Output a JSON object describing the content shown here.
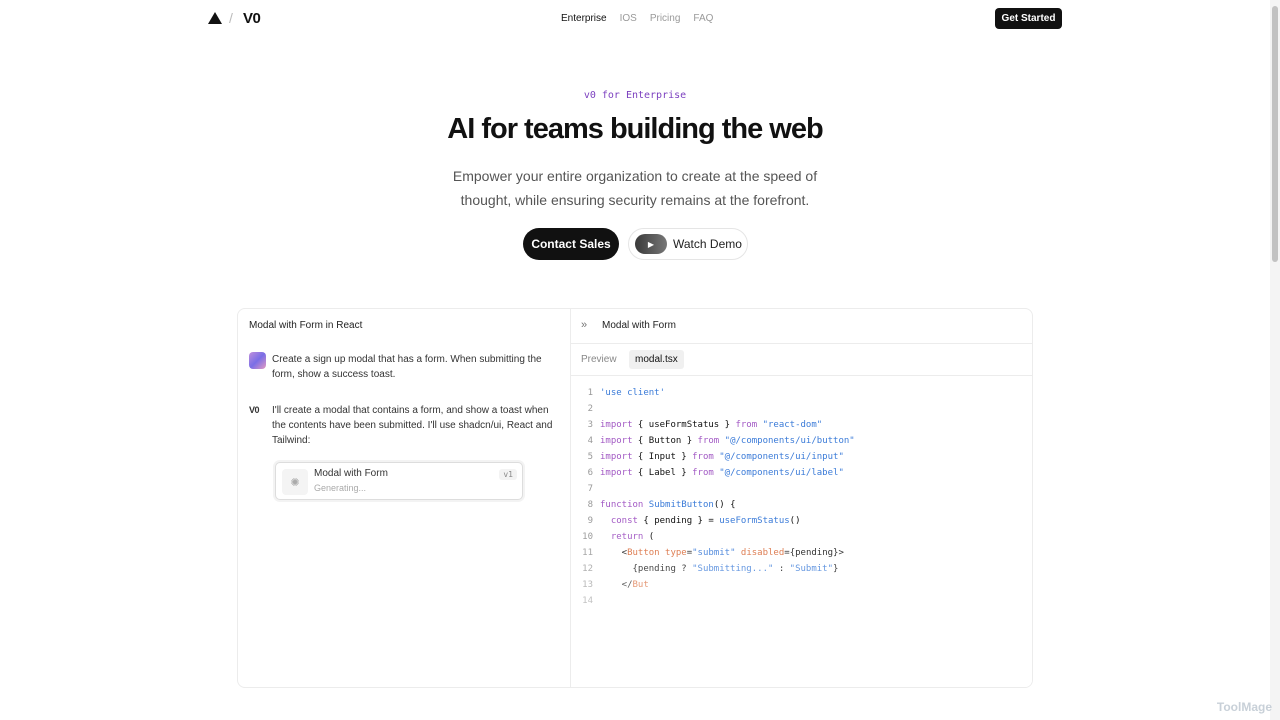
{
  "nav": {
    "logo_slash": "/",
    "logo_text": "V0",
    "links": [
      {
        "label": "Enterprise",
        "active": true
      },
      {
        "label": "IOS",
        "active": false
      },
      {
        "label": "Pricing",
        "active": false
      },
      {
        "label": "FAQ",
        "active": false
      }
    ],
    "cta": "Get Started"
  },
  "hero": {
    "eyebrow": "v0 for Enterprise",
    "title": "AI for teams building the web",
    "subtitle": "Empower your entire organization to create at the speed of thought, while ensuring security remains at the forefront.",
    "contact_btn": "Contact Sales",
    "demo_btn": "Watch Demo"
  },
  "demo": {
    "left_title": "Modal with Form in React",
    "user_msg": "Create a sign up modal that has a form. When submitting the form, show a success toast.",
    "bot_label": "V0",
    "bot_msg": "I'll create a modal that contains a form, and show a toast when the contents have been submitted. I'll use shadcn/ui, React and Tailwind:",
    "gen_title": "Modal with Form",
    "gen_status": "Generating...",
    "gen_version": "v1",
    "right_title": "Modal with Form",
    "tabs": [
      "Preview",
      "modal.tsx"
    ]
  },
  "watermark": "ToolMage",
  "colors": {
    "accent": "#7b3fbf",
    "dark": "#111111"
  }
}
